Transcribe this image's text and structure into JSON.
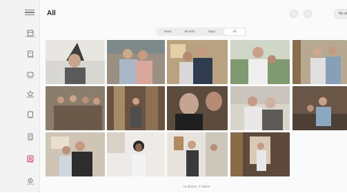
{
  "header": {
    "title": "All",
    "album_button": "My album"
  },
  "view_tabs": [
    "Years",
    "Months",
    "Days",
    "All"
  ],
  "active_tab": "All",
  "sidebar": {
    "items": [
      {
        "label": "Dashboard",
        "icon": "dashboard-icon"
      },
      {
        "label": "Journal",
        "icon": "journal-icon"
      },
      {
        "label": "Tasks",
        "icon": "tasks-icon"
      },
      {
        "label": "Rewards",
        "icon": "star-icon"
      },
      {
        "label": "Lists",
        "icon": "list-icon"
      },
      {
        "label": "Notes",
        "icon": "notes-icon"
      },
      {
        "label": "Photos",
        "icon": "photos-icon",
        "active": true
      },
      {
        "label": "Settings",
        "icon": "gear-icon"
      }
    ]
  },
  "footer": {
    "count": "14 photos, 0 videos"
  },
  "colors": {
    "accent": "#d12b4d",
    "background": "#fafafa",
    "sidebar": "#f3f3f3"
  }
}
